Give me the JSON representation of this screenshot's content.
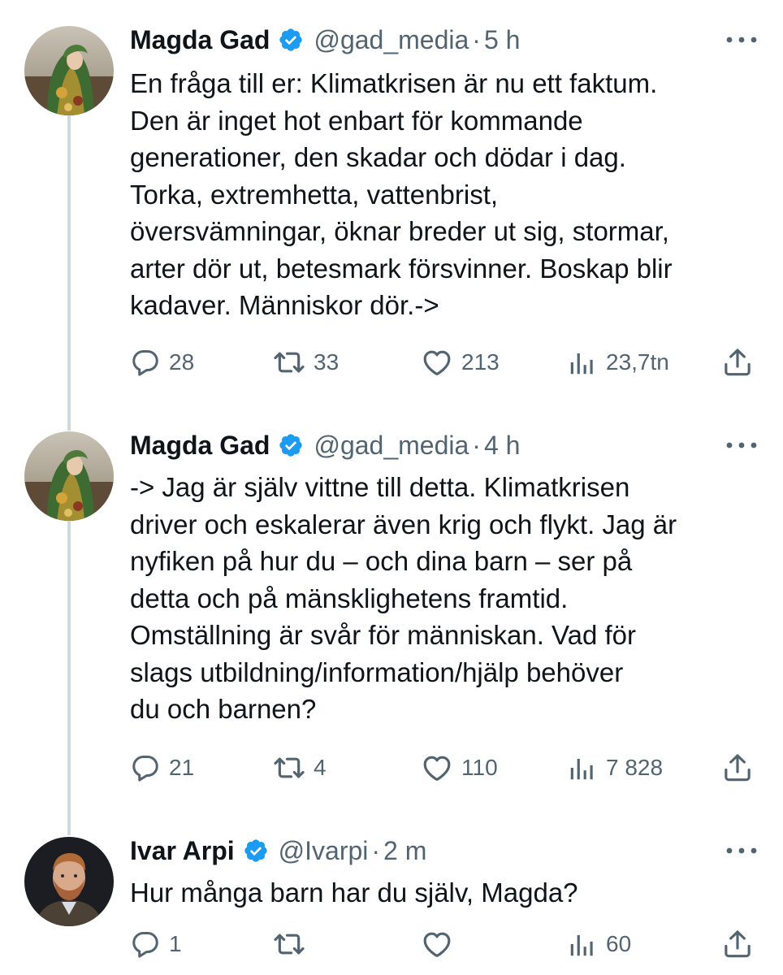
{
  "tweets": [
    {
      "name": "Magda Gad",
      "handle": "@gad_media",
      "separator": "·",
      "time": "5 h",
      "text": "En fråga till er: Klimatkrisen är nu ett faktum.\nDen är inget hot enbart för kommande\ngenerationer, den skadar och dödar i dag.\nTorka, extremhetta, vattenbrist,\növersvämningar, öknar breder ut sig, stormar,\narter dör ut, betesmark försvinner. Boskap blir\nkadaver. Människor dör.->",
      "replies": "28",
      "retweets": "33",
      "likes": "213",
      "views": "23,7tn"
    },
    {
      "name": "Magda Gad",
      "handle": "@gad_media",
      "separator": "·",
      "time": "4 h",
      "text": "-> Jag är själv vittne till detta. Klimatkrisen\ndriver och eskalerar även krig och flykt. Jag är\nnyfiken på hur du – och dina barn – ser på\ndetta och på mänsklighetens framtid.\nOmställning är svår för människan. Vad för\nslags utbildning/information/hjälp behöver\ndu och barnen?",
      "replies": "21",
      "retweets": "4",
      "likes": "110",
      "views": "7 828"
    },
    {
      "name": "Ivar Arpi",
      "handle": "@Ivarpi",
      "separator": "·",
      "time": "2 m",
      "text": "Hur många barn har du själv, Magda?",
      "replies": "1",
      "retweets": "",
      "likes": "",
      "views": "60"
    }
  ],
  "icons": {
    "verified": "verified-badge-icon",
    "more": "more-icon",
    "reply": "reply-icon",
    "retweet": "retweet-icon",
    "like": "like-icon",
    "views": "views-icon",
    "share": "share-icon"
  },
  "colors": {
    "text": "#0f1419",
    "secondary": "#536471",
    "verified": "#1d9bf0",
    "thread_line": "#cfd9de",
    "background": "#ffffff"
  }
}
